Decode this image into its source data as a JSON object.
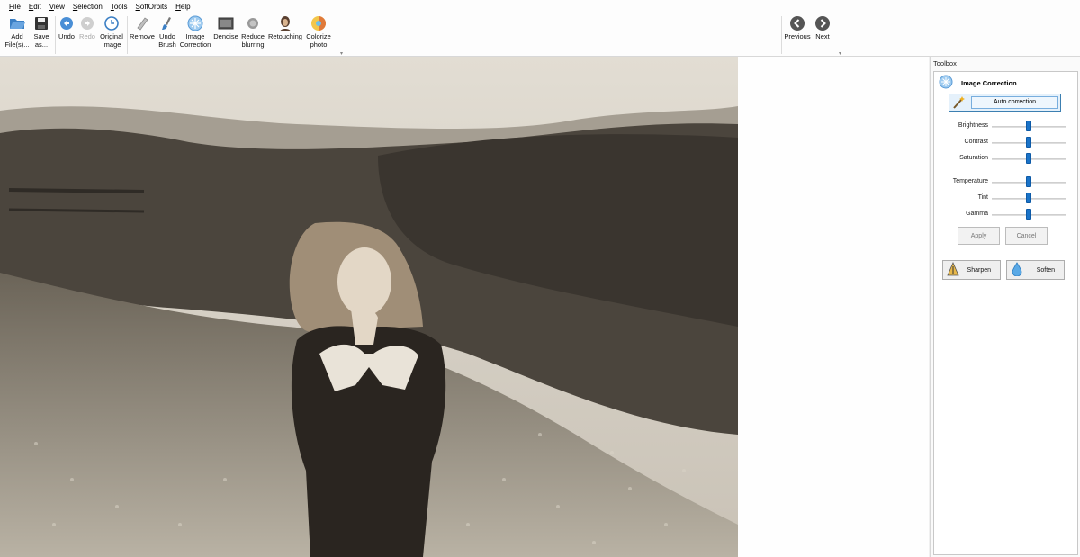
{
  "menu": [
    "File",
    "Edit",
    "View",
    "Selection",
    "Tools",
    "SoftOrbits",
    "Help"
  ],
  "toolbar": {
    "add_files": "Add\nFile(s)...",
    "save_as": "Save\nas...",
    "undo": "Undo",
    "redo": "Redo",
    "original_image": "Original\nImage",
    "remove": "Remove",
    "undo_brush": "Undo\nBrush",
    "image_correction": "Image\nCorrection",
    "denoise": "Denoise",
    "reduce_blurring": "Reduce\nblurring",
    "retouching": "Retouching",
    "colorize_photo": "Colorize\nphoto",
    "previous": "Previous",
    "next": "Next"
  },
  "toolbox": {
    "title": "Toolbox",
    "section_title": "Image Correction",
    "auto_correction": "Auto correction",
    "sliders": [
      {
        "label": "Brightness",
        "value": 0.5
      },
      {
        "label": "Contrast",
        "value": 0.5
      },
      {
        "label": "Saturation",
        "value": 0.5
      },
      {
        "label": "Temperature",
        "value": 0.5
      },
      {
        "label": "Tint",
        "value": 0.5
      },
      {
        "label": "Gamma",
        "value": 0.5
      }
    ],
    "apply": "Apply",
    "cancel": "Cancel",
    "sharpen": "Sharpen",
    "soften": "Soften"
  },
  "colors": {
    "accent": "#1a73c8",
    "photo_tone": "#8a8276"
  }
}
